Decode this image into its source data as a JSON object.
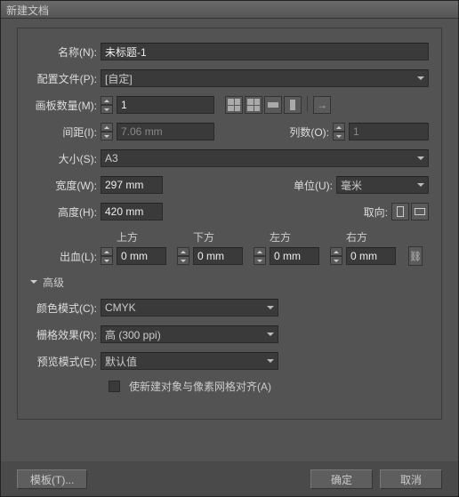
{
  "title": "新建文档",
  "labels": {
    "name": "名称(N):",
    "profile": "配置文件(P):",
    "artboards": "画板数量(M):",
    "spacing": "间距(I):",
    "columns": "列数(O):",
    "size": "大小(S):",
    "width": "宽度(W):",
    "units": "单位(U):",
    "height": "高度(H):",
    "orientation": "取向:",
    "bleed": "出血(L):",
    "top": "上方",
    "bottom": "下方",
    "left": "左方",
    "right": "右方",
    "advanced": "高级",
    "colorMode": "颜色模式(C):",
    "rasterEffects": "栅格效果(R):",
    "previewMode": "预览模式(E):",
    "alignGrid": "使新建对象与像素网格对齐(A)"
  },
  "values": {
    "name": "未标题-1",
    "profile": "[自定]",
    "artboards": "1",
    "spacing": "7.06 mm",
    "columns": "1",
    "size": "A3",
    "width": "297 mm",
    "height": "420 mm",
    "units": "毫米",
    "bleedTop": "0 mm",
    "bleedBottom": "0 mm",
    "bleedLeft": "0 mm",
    "bleedRight": "0 mm",
    "colorMode": "CMYK",
    "rasterEffects": "高 (300 ppi)",
    "previewMode": "默认值"
  },
  "buttons": {
    "template": "模板(T)...",
    "ok": "确定",
    "cancel": "取消"
  }
}
